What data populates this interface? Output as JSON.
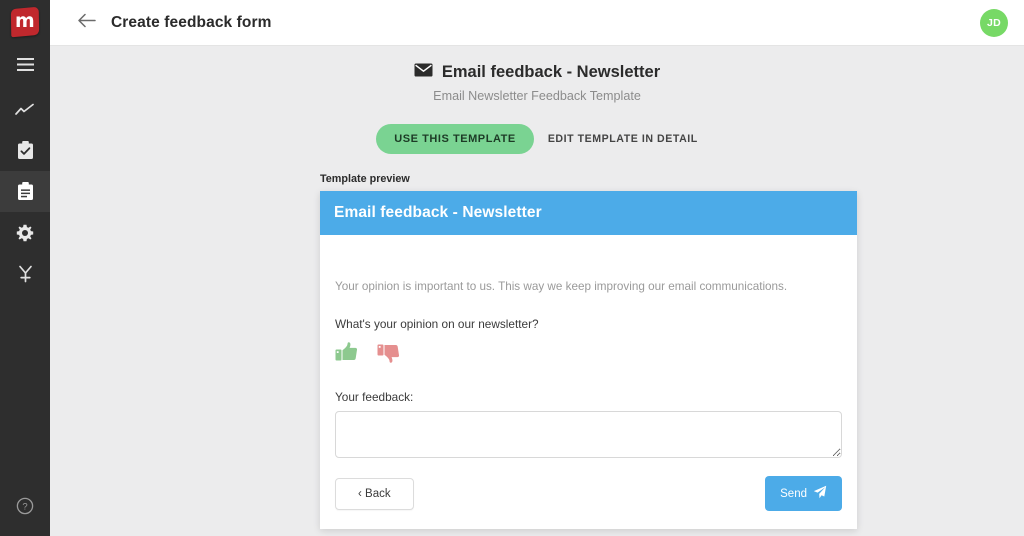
{
  "sidebar": {
    "logo": {
      "name": "brand-logo",
      "letter": "m",
      "color": "#c0282d"
    },
    "items": [
      {
        "icon": "hamburger-menu-icon",
        "label": "Menu",
        "active": false
      },
      {
        "icon": "trend-chart-icon",
        "label": "Analytics",
        "active": false
      },
      {
        "icon": "clipboard-check-icon",
        "label": "Tasks",
        "active": false
      },
      {
        "icon": "clipboard-list-icon",
        "label": "Forms",
        "active": true
      },
      {
        "icon": "gear-icon",
        "label": "Settings",
        "active": false
      },
      {
        "icon": "workflow-merge-icon",
        "label": "Workflow",
        "active": false
      }
    ],
    "help": {
      "icon": "help-circle-icon",
      "label": "Help"
    }
  },
  "topbar": {
    "back_icon": "arrow-left-icon",
    "title": "Create feedback form",
    "avatar_initials": "JD",
    "avatar_color": "#77d966"
  },
  "template": {
    "icon": "envelope-icon",
    "title": "Email feedback - Newsletter",
    "subtitle": "Email Newsletter Feedback Template",
    "use_button": "USE THIS TEMPLATE",
    "edit_link": "EDIT TEMPLATE IN DETAIL",
    "use_button_color": "#7ad392"
  },
  "preview": {
    "label": "Template preview",
    "header_color": "#4cabe8",
    "header_title": "Email feedback - Newsletter",
    "intro": "Your opinion is important to us. This way we keep improving our email communications.",
    "question": "What's your opinion on our newsletter?",
    "thumbs_up_icon": "thumbs-up-icon",
    "thumbs_up_color": "#8dc98f",
    "thumbs_down_icon": "thumbs-down-icon",
    "thumbs_down_color": "#e58f8f",
    "feedback_label": "Your feedback:",
    "feedback_value": "",
    "feedback_placeholder": "",
    "back_button": "‹ Back",
    "send_button": "Send",
    "send_icon": "paper-plane-icon"
  }
}
